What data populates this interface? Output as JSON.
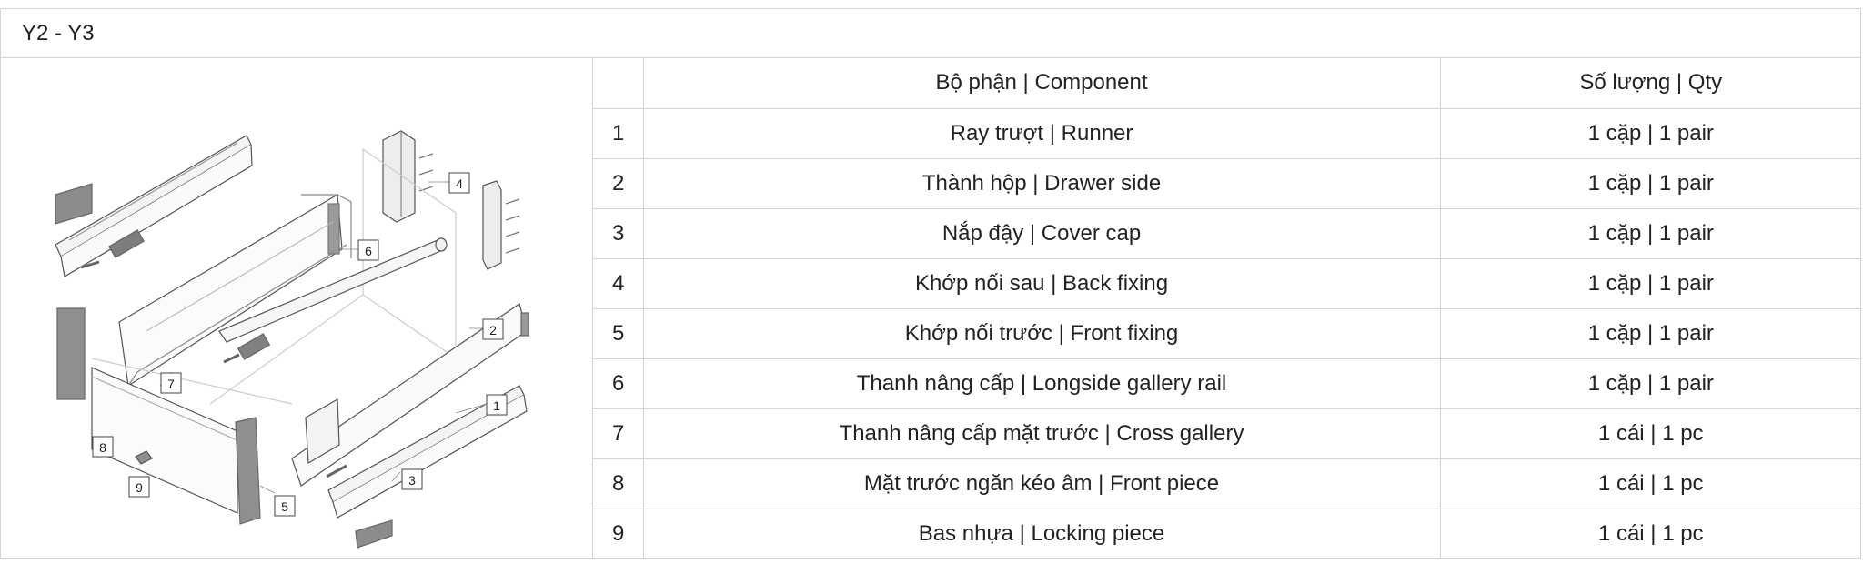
{
  "title": "Y2 - Y3",
  "table": {
    "header": {
      "num": "",
      "component": "Bộ phận | Component",
      "qty": "Số lượng | Qty"
    },
    "rows": [
      {
        "num": "1",
        "component": "Ray trượt | Runner",
        "qty": "1 cặp | 1 pair"
      },
      {
        "num": "2",
        "component": "Thành hộp | Drawer side",
        "qty": "1 cặp | 1 pair"
      },
      {
        "num": "3",
        "component": "Nắp đậy | Cover cap",
        "qty": "1 cặp | 1 pair"
      },
      {
        "num": "4",
        "component": "Khớp nối sau | Back fixing",
        "qty": "1 cặp | 1 pair"
      },
      {
        "num": "5",
        "component": "Khớp nối trước | Front fixing",
        "qty": "1 cặp | 1 pair"
      },
      {
        "num": "6",
        "component": "Thanh nâng cấp | Longside gallery rail",
        "qty": "1 cặp | 1 pair"
      },
      {
        "num": "7",
        "component": "Thanh nâng cấp mặt trước | Cross gallery",
        "qty": "1 cái | 1 pc"
      },
      {
        "num": "8",
        "component": "Mặt trước ngăn kéo âm | Front piece",
        "qty": "1 cái | 1 pc"
      },
      {
        "num": "9",
        "component": "Bas nhựa | Locking piece",
        "qty": "1 cái | 1 pc"
      }
    ]
  },
  "diagram": {
    "callouts": {
      "c1": "1",
      "c2": "2",
      "c3": "3",
      "c4": "4",
      "c5": "5",
      "c6": "6",
      "c7": "7",
      "c8": "8",
      "c9": "9"
    }
  }
}
